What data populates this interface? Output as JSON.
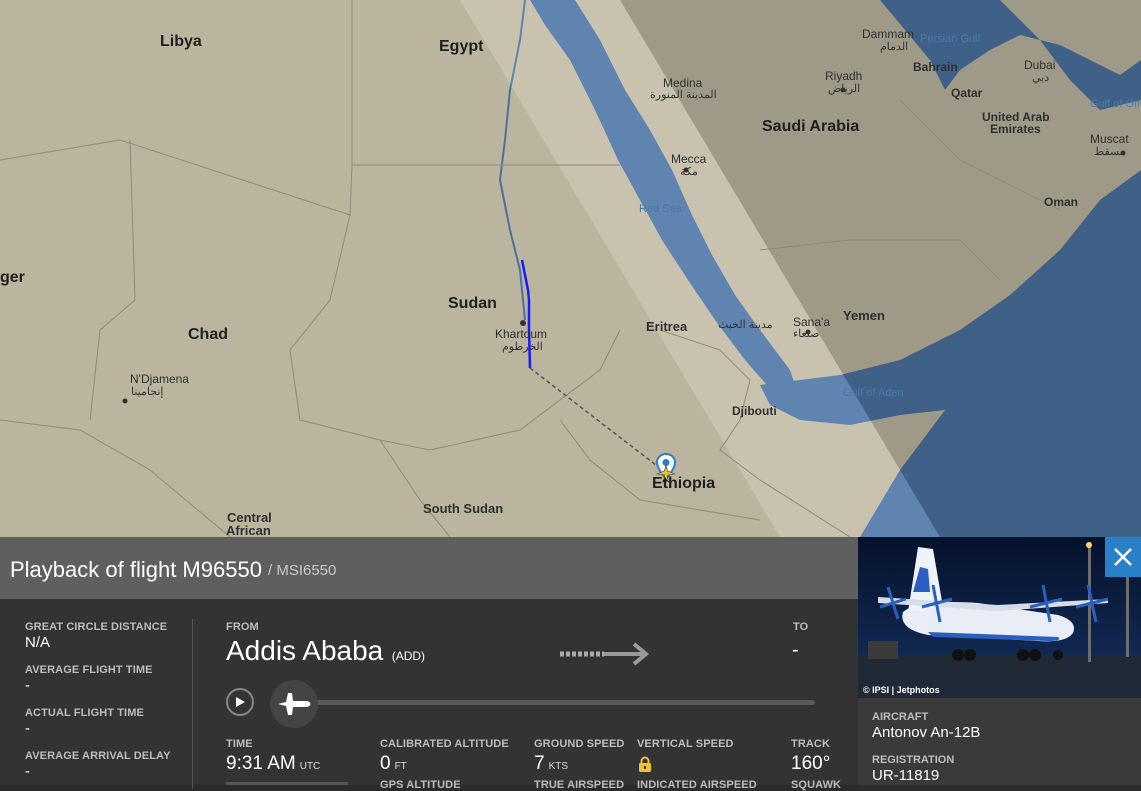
{
  "map": {
    "countries": {
      "libya": "Libya",
      "egypt": "Egypt",
      "sudan": "Sudan",
      "chad": "Chad",
      "eritrea": "Eritrea",
      "ethiopia": "Ethiopia",
      "south_sudan": "South Sudan",
      "central_african": "Central",
      "central_african_2": "African",
      "saudi_arabia": "Saudi Arabia",
      "yemen": "Yemen",
      "oman": "Oman",
      "djibouti": "Djibouti",
      "bahrain": "Bahrain",
      "qatar": "Qatar",
      "uae": "United Arab",
      "uae_2": "Emirates",
      "niger": "ger"
    },
    "cities": {
      "khartoum": "Khartoum",
      "khartoum_ar": "الخرطوم",
      "ndjamena": "N'Djamena",
      "ndjamena_ar": "إنجامينا",
      "medina": "Medina",
      "medina_ar": "المدينة المنورة",
      "mecca": "Mecca",
      "mecca_ar": "مكة",
      "riyadh": "Riyadh",
      "riyadh_ar": "الرياض",
      "dammam": "Dammam",
      "dammam_ar": "الدمام",
      "dubai": "Dubai",
      "dubai_ar": "دبي",
      "muscat": "Muscat",
      "muscat_ar": "مسقط",
      "sanaa": "Sana'a",
      "sanaa_ar": "صنعاء",
      "asmara_ar": "مدينة الخبث"
    },
    "water": {
      "red_sea": "Red Sea",
      "gulf_of_aden": "Gulf of Aden",
      "persian_gulf": "Persian Gulf",
      "gulf_of_oman": "Gulf of Om"
    },
    "colors": {
      "track": "#1a1aff",
      "land": "#b9b29d",
      "water": "#3f6a9c"
    }
  },
  "playback": {
    "title": "Playback of flight M96550",
    "subtitle": "/ MSI6550"
  },
  "stats": {
    "great_circle_label": "GREAT CIRCLE DISTANCE",
    "great_circle_value": "N/A",
    "avg_flight_time_label": "AVERAGE FLIGHT TIME",
    "avg_flight_time_value": "-",
    "actual_flight_time_label": "ACTUAL FLIGHT TIME",
    "actual_flight_time_value": "-",
    "avg_arrival_delay_label": "AVERAGE ARRIVAL DELAY",
    "avg_arrival_delay_value": "-",
    "from_label": "FROM",
    "from_city": "Addis Ababa",
    "from_code": "(ADD)",
    "to_label": "TO",
    "to_value": "-",
    "time_label": "TIME",
    "time_value": "9:31 AM",
    "time_unit": "UTC",
    "cal_alt_label": "CALIBRATED ALTITUDE",
    "cal_alt_value": "0",
    "cal_alt_unit": "FT",
    "ground_speed_label": "GROUND SPEED",
    "ground_speed_value": "7",
    "ground_speed_unit": "KTS",
    "vertical_speed_label": "VERTICAL SPEED",
    "track_label": "TRACK",
    "track_value": "160°",
    "gps_alt_label": "GPS ALTITUDE",
    "true_airspeed_label": "TRUE AIRSPEED",
    "indicated_airspeed_label": "INDICATED AIRSPEED",
    "squawk_label": "SQUAWK"
  },
  "aircraft": {
    "photo_credit": "© IPSI | Jetphotos",
    "aircraft_label": "AIRCRAFT",
    "aircraft_value": "Antonov An-12B",
    "registration_label": "REGISTRATION",
    "registration_value": "UR-11819"
  }
}
